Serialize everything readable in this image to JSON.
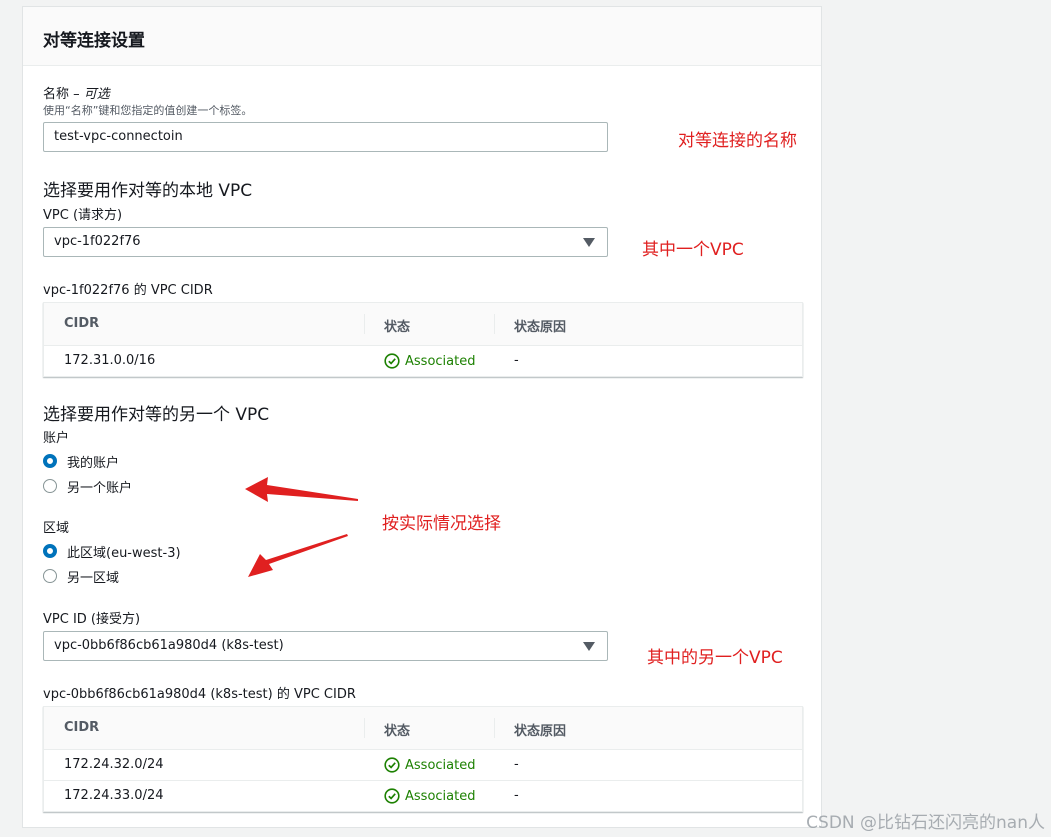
{
  "panel": {
    "title": "对等连接设置"
  },
  "name_field": {
    "label": "名称",
    "optional": "可选",
    "description": "使用“名称”键和您指定的值创建一个标签。",
    "value": "test-vpc-connectoin"
  },
  "local_vpc": {
    "heading": "选择要用作对等的本地 VPC",
    "label": "VPC (请求方)",
    "selected": "vpc-1f022f76",
    "cidr_title": "vpc-1f022f76 的 VPC CIDR",
    "table": {
      "headers": [
        "CIDR",
        "状态",
        "状态原因"
      ],
      "rows": [
        {
          "cidr": "172.31.0.0/16",
          "status": "Associated",
          "reason": "-"
        }
      ]
    }
  },
  "peer_vpc": {
    "heading": "选择要用作对等的另一个 VPC",
    "account_label": "账户",
    "account_options": [
      {
        "label": "我的账户",
        "selected": true
      },
      {
        "label": "另一个账户",
        "selected": false
      }
    ],
    "region_label": "区域",
    "region_options": [
      {
        "label": "此区域(eu-west-3)",
        "selected": true
      },
      {
        "label": "另一区域",
        "selected": false
      }
    ],
    "vpc_label": "VPC ID (接受方)",
    "selected": "vpc-0bb6f86cb61a980d4 (k8s-test)",
    "cidr_title": "vpc-0bb6f86cb61a980d4 (k8s-test) 的 VPC CIDR",
    "table": {
      "headers": [
        "CIDR",
        "状态",
        "状态原因"
      ],
      "rows": [
        {
          "cidr": "172.24.32.0/24",
          "status": "Associated",
          "reason": "-"
        },
        {
          "cidr": "172.24.33.0/24",
          "status": "Associated",
          "reason": "-"
        }
      ]
    }
  },
  "annotations": {
    "name_note": "对等连接的名称",
    "local_vpc_note": "其中一个VPC",
    "choose_note": "按实际情况选择",
    "peer_vpc_note": "其中的另一个VPC",
    "color": "#e02020"
  },
  "watermark": "CSDN @比钻石还闪亮的nan人",
  "colors": {
    "primary": "#0073bb",
    "success": "#1d8102",
    "panel_bg": "#ffffff",
    "page_bg": "#f2f3f3"
  },
  "icons": {
    "status": "check-circle-icon",
    "dropdown": "caret-down-icon"
  }
}
